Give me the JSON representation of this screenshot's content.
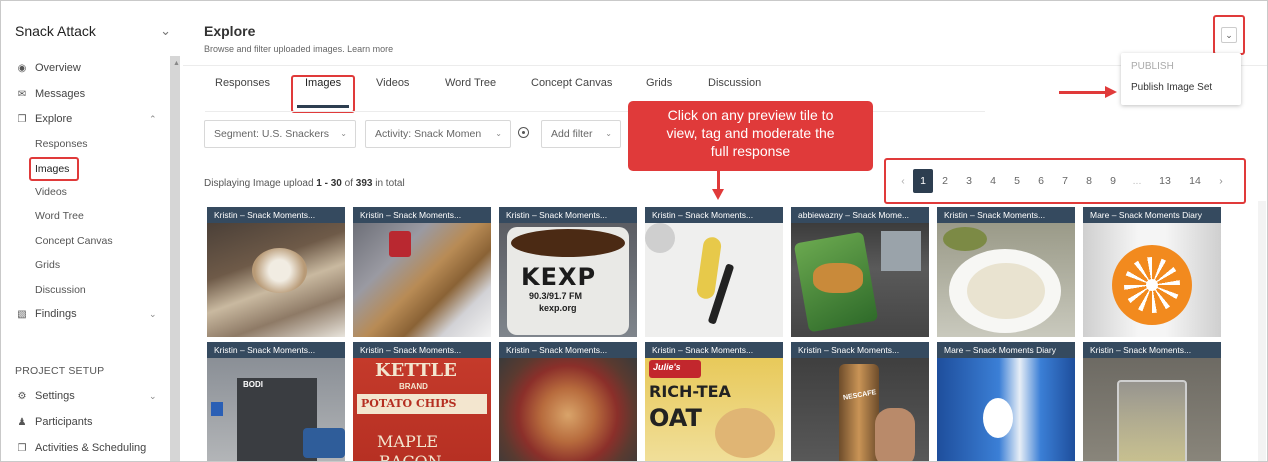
{
  "sidebar": {
    "brand": "Snack Attack",
    "nav": [
      {
        "label": "Overview",
        "icon": "dashboard-icon"
      },
      {
        "label": "Messages",
        "icon": "envelope-icon"
      },
      {
        "label": "Explore",
        "icon": "copy-icon"
      }
    ],
    "explore_items": [
      "Responses",
      "Images",
      "Videos",
      "Word Tree",
      "Concept Canvas",
      "Grids",
      "Discussion"
    ],
    "findings": "Findings",
    "project_setup_heading": "PROJECT SETUP",
    "setup_items": [
      {
        "label": "Settings",
        "icon": "gear-icon"
      },
      {
        "label": "Participants",
        "icon": "user-icon"
      },
      {
        "label": "Activities & Scheduling",
        "icon": "copy-icon"
      }
    ]
  },
  "header": {
    "title": "Explore",
    "subtitle": "Browse and filter uploaded images.",
    "learn_more": "Learn more"
  },
  "publish_menu": {
    "heading": "PUBLISH",
    "item": "Publish Image Set"
  },
  "tabs": [
    "Responses",
    "Images",
    "Videos",
    "Word Tree",
    "Concept Canvas",
    "Grids",
    "Discussion"
  ],
  "active_tab": "Images",
  "filters": {
    "segment": "Segment: U.S. Snackers",
    "activity": "Activity: Snack Momen",
    "add": "Add filter"
  },
  "callout": {
    "line1": "Click on any preview tile to",
    "line2": "view, tag and moderate the",
    "line3": "full response"
  },
  "results": {
    "prefix": "Displaying Image upload ",
    "range": "1 - 30",
    "of": " of ",
    "total": "393",
    "suffix": " in total"
  },
  "pagination": {
    "prev": "‹",
    "pages": [
      "1",
      "2",
      "3",
      "4",
      "5",
      "6",
      "7",
      "8",
      "9",
      "...",
      "13",
      "14"
    ],
    "next": "›",
    "current": "1"
  },
  "tiles": [
    {
      "caption": "Kristin – Snack Moments..."
    },
    {
      "caption": "Kristin – Snack Moments..."
    },
    {
      "caption": "Kristin – Snack Moments..."
    },
    {
      "caption": "Kristin – Snack Moments..."
    },
    {
      "caption": "abbiewazny – Snack Mome..."
    },
    {
      "caption": "Kristin – Snack Moments..."
    },
    {
      "caption": "Mare – Snack Moments Diary"
    },
    {
      "caption": "Kristin – Snack Moments..."
    },
    {
      "caption": "Kristin – Snack Moments..."
    },
    {
      "caption": "Kristin – Snack Moments..."
    },
    {
      "caption": "Kristin – Snack Moments..."
    },
    {
      "caption": "Kristin – Snack Moments..."
    },
    {
      "caption": "Mare – Snack Moments Diary"
    },
    {
      "caption": "Kristin – Snack Moments..."
    }
  ],
  "tile_text": {
    "kexp": "KEXP",
    "kexp_freq": "90.3/91.7 FM",
    "kexp_url": "kexp.org",
    "bodi": "BODI",
    "kettle": "KETTLE",
    "brand": "BRAND",
    "potato": "POTATO CHIPS",
    "maple": "MAPLE",
    "bacon": "BACON",
    "julie": "Julie's",
    "rich": "RICH-TEA",
    "oat": "OAT",
    "nescafe": "NESCAFE"
  },
  "colors": {
    "accent_red": "#e03a3a",
    "caption_bg": "#354a5f",
    "active_tab": "#2d3e50"
  }
}
